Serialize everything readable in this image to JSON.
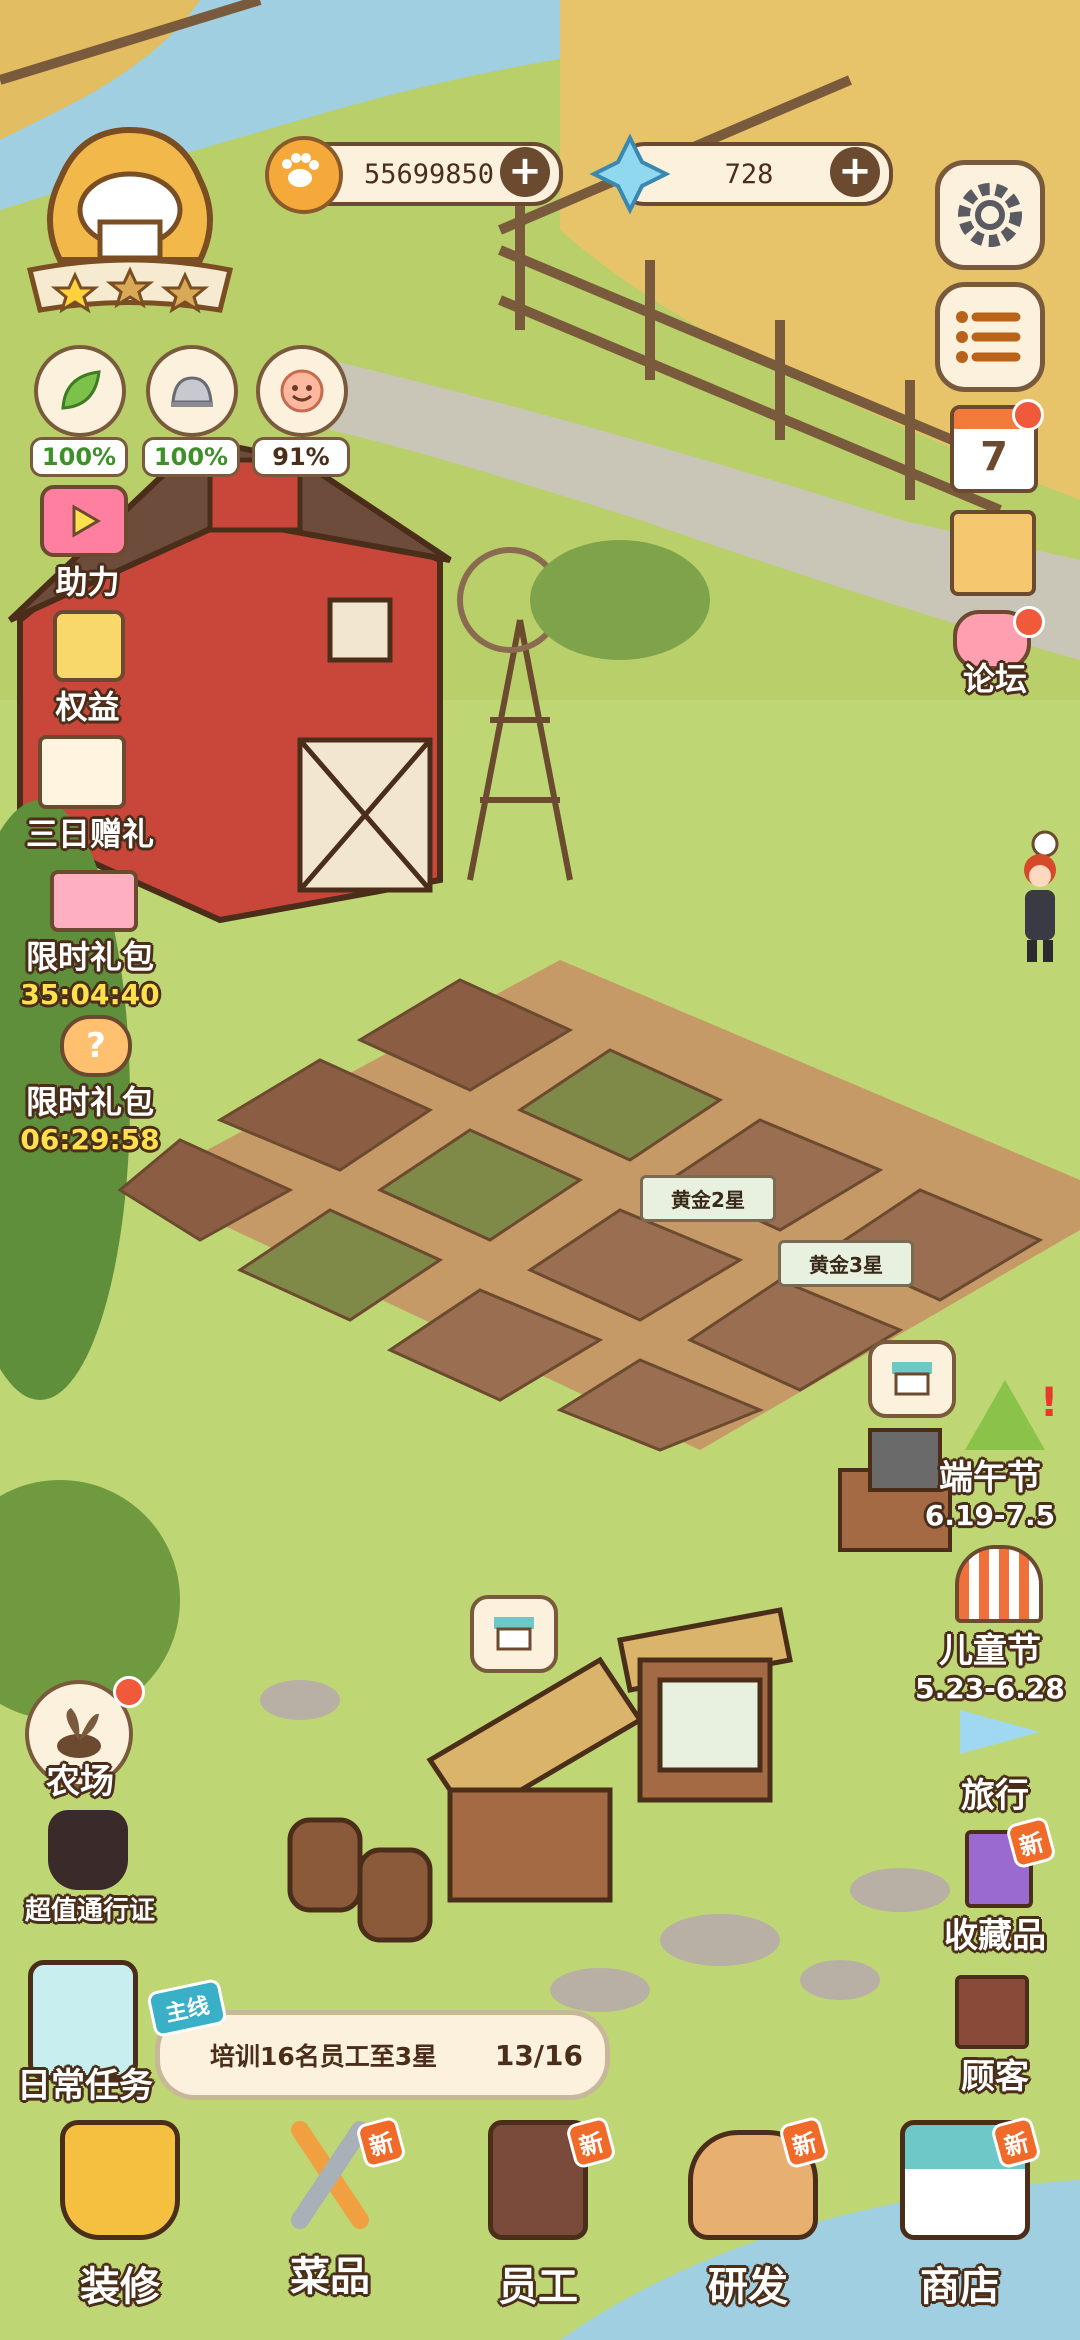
{
  "currency": {
    "paw_coins": "55699850",
    "gems": "728"
  },
  "status": {
    "stat1": "100%",
    "stat2": "100%",
    "stat3": "91%"
  },
  "calendar_day": "7",
  "left_menu": {
    "boost": "助力",
    "benefits": "权益",
    "three_day_gift": "三日赠礼",
    "limited_pack_1": "限时礼包",
    "limited_pack_1_timer": "35:04:40",
    "limited_pack_2": "限时礼包",
    "limited_pack_2_timer": "06:29:58",
    "farm": "农场",
    "pass": "超值通行证",
    "daily_tasks": "日常任务"
  },
  "right_menu": {
    "forum": "论坛",
    "dragon_boat": "端午节",
    "dragon_boat_dates": "6.19-7.5",
    "childrens_day": "儿童节",
    "childrens_day_dates": "5.23-6.28",
    "travel": "旅行",
    "collectibles": "收藏品",
    "collectibles_tag": "新",
    "customers": "顾客"
  },
  "field_signs": {
    "sign1": "黄金2星",
    "sign2": "黄金3星"
  },
  "quest": {
    "tag": "主线",
    "text": "培训16名员工至3星",
    "progress": "13/16"
  },
  "bottom_nav": [
    {
      "label": "装修",
      "tag": ""
    },
    {
      "label": "菜品",
      "tag": "新"
    },
    {
      "label": "员工",
      "tag": "新"
    },
    {
      "label": "研发",
      "tag": "新"
    },
    {
      "label": "商店",
      "tag": "新"
    }
  ],
  "colors": {
    "grass": "#b9cf6a",
    "path": "#c9c6b8",
    "barn_red": "#c9473a",
    "outline": "#4a2e1a",
    "wheat": "#e7c36a",
    "water": "#9fcfe0"
  }
}
